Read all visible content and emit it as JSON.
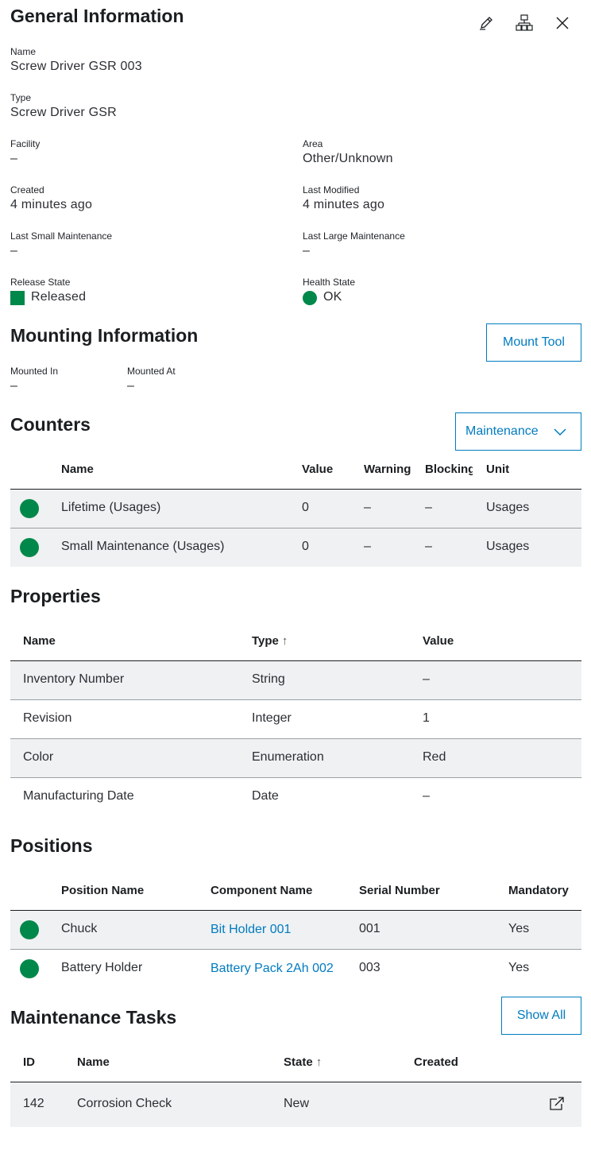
{
  "general": {
    "title": "General Information",
    "fields": {
      "name_label": "Name",
      "name_value": "Screw Driver GSR 003",
      "type_label": "Type",
      "type_value": "Screw Driver GSR",
      "facility_label": "Facility",
      "facility_value": "–",
      "area_label": "Area",
      "area_value": "Other/Unknown",
      "created_label": "Created",
      "created_value": "4 minutes ago",
      "modified_label": "Last Modified",
      "modified_value": "4 minutes ago",
      "small_maint_label": "Last Small Maintenance",
      "small_maint_value": "–",
      "large_maint_label": "Last Large Maintenance",
      "large_maint_value": "–",
      "release_label": "Release State",
      "release_value": "Released",
      "health_label": "Health State",
      "health_value": "OK"
    },
    "icons": {
      "edit": "pencil-icon",
      "hierarchy": "hierarchy-icon",
      "close": "close-icon"
    }
  },
  "colors": {
    "accent": "#007bc0",
    "success": "#00884a",
    "row_bg": "#eff1f2"
  },
  "mounting": {
    "title": "Mounting Information",
    "button": "Mount Tool",
    "mounted_in_label": "Mounted In",
    "mounted_in_value": "–",
    "mounted_at_label": "Mounted At",
    "mounted_at_value": "–"
  },
  "counters": {
    "title": "Counters",
    "dropdown": "Maintenance",
    "columns": [
      "Name",
      "Value",
      "Warning",
      "Blocking",
      "Unit"
    ],
    "rows": [
      {
        "name": "Lifetime (Usages)",
        "value": "0",
        "warning": "–",
        "blocking": "–",
        "unit": "Usages"
      },
      {
        "name": "Small Maintenance (Usages)",
        "value": "0",
        "warning": "–",
        "blocking": "–",
        "unit": "Usages"
      }
    ]
  },
  "properties": {
    "title": "Properties",
    "columns": [
      "Name",
      "Type",
      "Value"
    ],
    "rows": [
      {
        "name": "Inventory Number",
        "type": "String",
        "value": "–"
      },
      {
        "name": "Revision",
        "type": "Integer",
        "value": "1"
      },
      {
        "name": "Color",
        "type": "Enumeration",
        "value": "Red"
      },
      {
        "name": "Manufacturing Date",
        "type": "Date",
        "value": "–"
      }
    ]
  },
  "positions": {
    "title": "Positions",
    "columns": [
      "Position Name",
      "Component Name",
      "Serial Number",
      "Mandatory"
    ],
    "rows": [
      {
        "position": "Chuck",
        "component": "Bit Holder 001",
        "serial": "001",
        "mandatory": "Yes"
      },
      {
        "position": "Battery Holder",
        "component": "Battery Pack 2Ah 002",
        "serial": "003",
        "mandatory": "Yes"
      }
    ]
  },
  "tasks": {
    "title": "Maintenance Tasks",
    "button": "Show All",
    "columns": [
      "ID",
      "Name",
      "State",
      "Created"
    ],
    "rows": [
      {
        "id": "142",
        "name": "Corrosion Check",
        "state": "New",
        "created": ""
      }
    ]
  }
}
